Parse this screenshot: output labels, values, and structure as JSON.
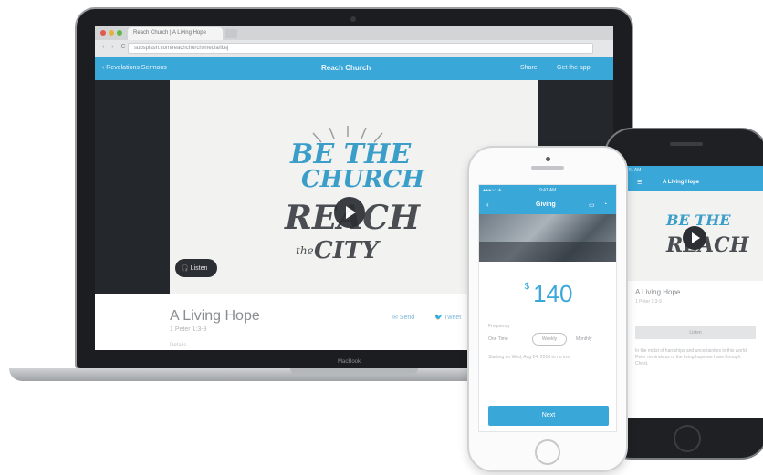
{
  "browser": {
    "tab_title": "Reach Church | A Living Hope",
    "url": "subsplash.com/reachchurch/media/lbsj",
    "nav": "‹ › C"
  },
  "app_bar": {
    "back_label": "‹ Revelations Sermons",
    "brand": "Reach Church",
    "share_label": "Share",
    "get_app_label": "Get the app"
  },
  "artwork": {
    "line1": "BE THE",
    "line2": "CHURCH",
    "line3": "REACH",
    "line4_small": "the",
    "line5": "CITY"
  },
  "listen_label": "Listen",
  "sermon": {
    "title": "A Living Hope",
    "reference": "1 Peter 1:3-9",
    "meta": "Details",
    "send_label": "Send",
    "tweet_label": "Tweet"
  },
  "laptop_label": "MacBook",
  "phone_back": {
    "status": "9:41 AM",
    "title": "A Living Hope",
    "menu": "☰",
    "art_line1": "BE THE",
    "art_line2": "REACH",
    "sermon_title": "A Living Hope",
    "sermon_sub": "1 Peter 1:3-9",
    "listen_button": "Listen",
    "description": "In the midst of hardships and uncertainties in this world, Peter reminds us of the living hope we have through Christ."
  },
  "phone_front": {
    "status_left": "●●●○○ ✈",
    "status_time": "9:41 AM",
    "title": "Giving",
    "back": "‹",
    "menu_icon": "☰",
    "cast_icon": "▭",
    "user_icon": "◔",
    "currency": "$",
    "amount": "140",
    "frequency_label": "Frequency",
    "frequency_options": [
      "One Time",
      "Weekly",
      "Monthly"
    ],
    "frequency_selected": "Weekly",
    "note": "Starting on Wed, Aug 24, 2016 to no end",
    "next_button": "Next"
  },
  "colors": {
    "brand_blue": "#3aa7d9",
    "dark_frame": "#1b1d20",
    "text_gray": "#8a8d91"
  }
}
